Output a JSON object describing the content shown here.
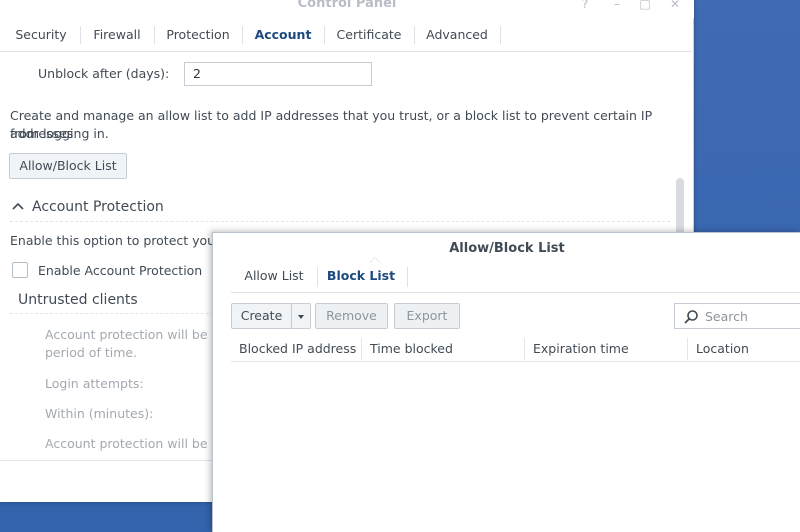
{
  "window": {
    "title": "Control Panel",
    "controls": [
      "?",
      "–",
      "□",
      "✕"
    ]
  },
  "tabs": [
    "Security",
    "Firewall",
    "Protection",
    "Account",
    "Certificate",
    "Advanced"
  ],
  "active_tab": "Account",
  "account": {
    "unblock_label": "Unblock after (days):",
    "unblock_value": "2",
    "description_line1": "Create and manage an allow list to add IP addresses that you trust, or a block list to prevent certain IP addresses",
    "description_line2": "from logging in.",
    "allow_block_button": "Allow/Block List",
    "section_title": "Account Protection",
    "enable_desc": "Enable this option to protect your a",
    "enable_checkbox_label": "Enable Account Protection",
    "untrusted_title": "Untrusted clients",
    "untrusted_desc_line1": "Account protection will be trig",
    "untrusted_desc_line2": "period of time.",
    "login_attempts_label": "Login attempts:",
    "within_minutes_label": "Within (minutes):",
    "cancel_desc": "Account protection will be car"
  },
  "dialog": {
    "title": "Allow/Block List",
    "tabs": [
      "Allow List",
      "Block List"
    ],
    "active_tab": "Block List",
    "toolbar": {
      "create": "Create",
      "remove": "Remove",
      "export": "Export",
      "search_placeholder": "Search"
    },
    "columns": [
      "Blocked IP address",
      "Time blocked",
      "Expiration time",
      "Location"
    ],
    "rows": []
  },
  "colors": {
    "desktop": "#3b67b0",
    "accent_text": "#1c4a7e",
    "border": "#c5ccd4"
  }
}
